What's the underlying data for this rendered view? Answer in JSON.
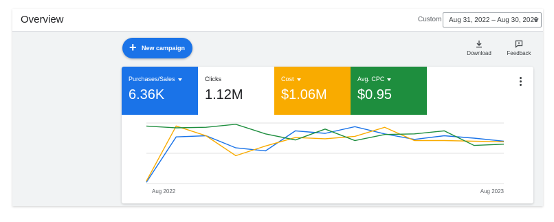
{
  "header": {
    "title": "Overview",
    "custom_label": "Custom",
    "date_range": "Aug 31, 2022 – Aug 30, 2023"
  },
  "actions": {
    "new_campaign": "New campaign",
    "download": "Download",
    "feedback": "Feedback"
  },
  "metrics": [
    {
      "label": "Purchases/Sales",
      "value": "6.36K",
      "bg": "#1a73e8",
      "fg": "#ffffff",
      "dropdown": true
    },
    {
      "label": "Clicks",
      "value": "1.12M",
      "bg": "#ffffff",
      "fg": "#202124",
      "dropdown": false
    },
    {
      "label": "Cost",
      "value": "$1.06M",
      "bg": "#f9ab00",
      "fg": "#ffffff",
      "dropdown": true
    },
    {
      "label": "Avg. CPC",
      "value": "$0.95",
      "bg": "#1e8e3e",
      "fg": "#ffffff",
      "dropdown": true
    }
  ],
  "chart_data": {
    "type": "line",
    "x_labels": [
      "Aug 2022",
      "Aug 2023"
    ],
    "grid": true,
    "y_axis_labels_shown": false,
    "series": [
      {
        "color": "#1a73e8",
        "values": [
          0.02,
          0.77,
          0.79,
          0.59,
          0.54,
          0.87,
          0.83,
          0.94,
          0.82,
          0.73,
          0.79,
          0.75,
          0.7
        ]
      },
      {
        "color": "#f9ab00",
        "values": [
          0.04,
          0.95,
          0.79,
          0.46,
          0.62,
          0.76,
          0.74,
          0.78,
          0.93,
          0.71,
          0.71,
          0.7,
          0.69
        ]
      },
      {
        "color": "#1e8e3e",
        "values": [
          0.95,
          0.92,
          0.93,
          0.98,
          0.82,
          0.72,
          0.9,
          0.71,
          0.81,
          0.82,
          0.87,
          0.63,
          0.65
        ]
      }
    ]
  }
}
